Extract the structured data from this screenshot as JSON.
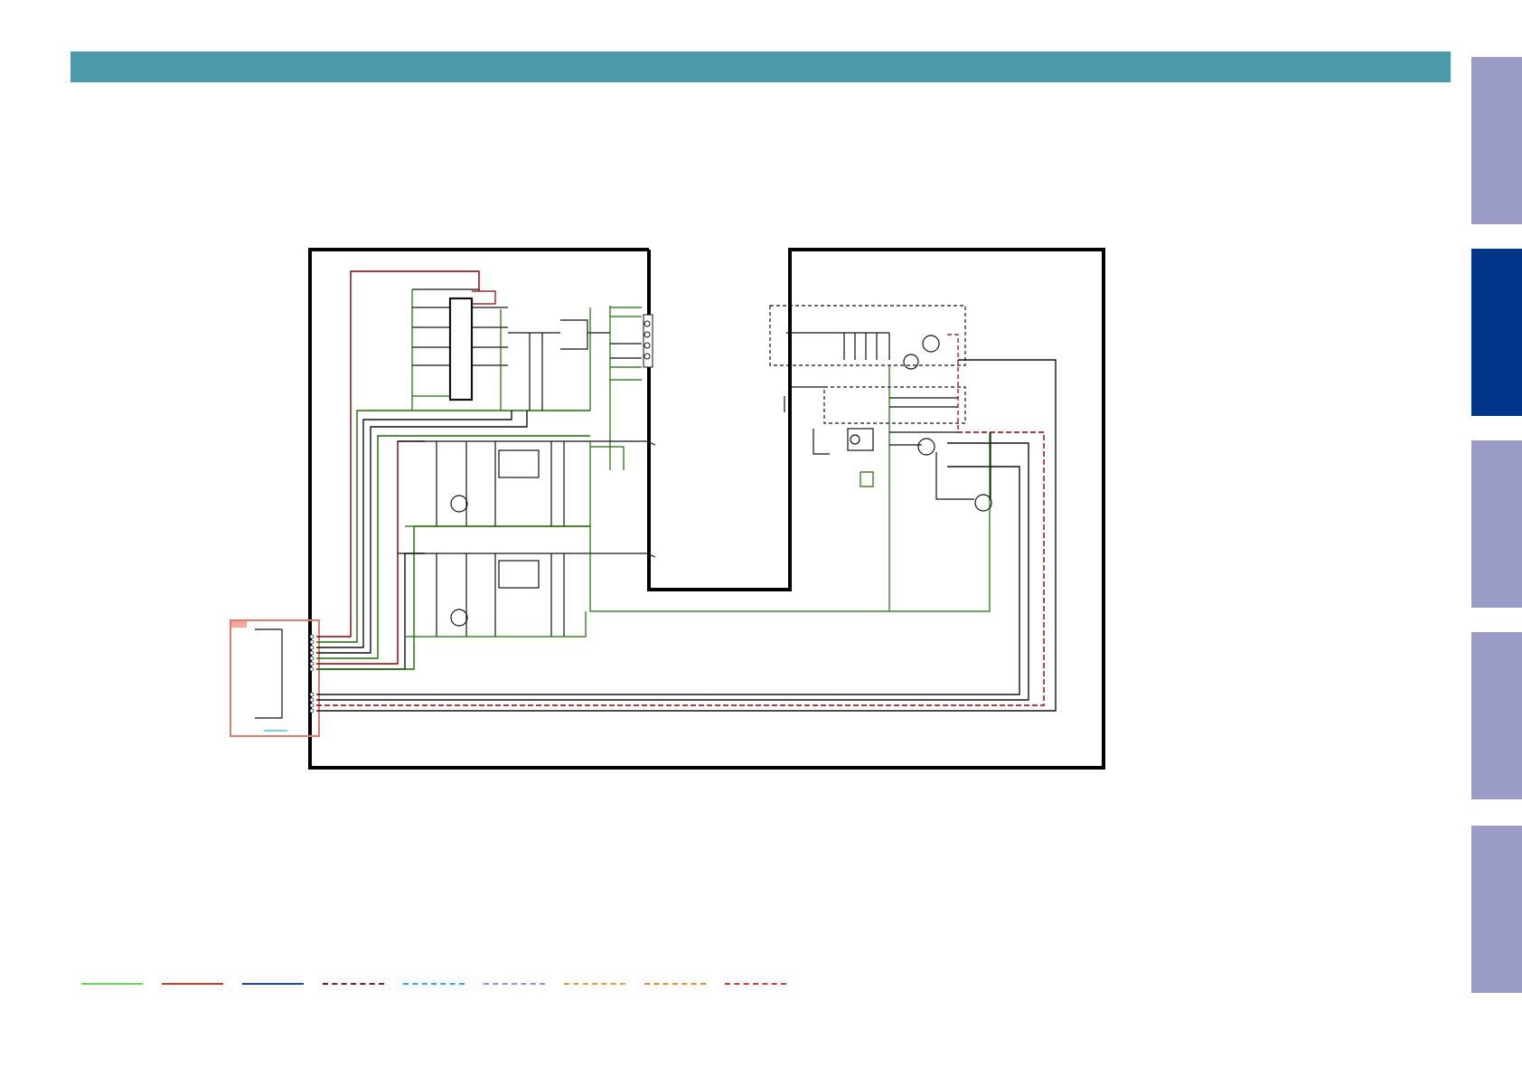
{
  "colors": {
    "header_bar": "#4a9aab",
    "side_tab_inactive": "#9b9bc8",
    "side_tab_active": "#00358a",
    "wire_black": "#111111",
    "wire_green": "#1a6b00",
    "wire_red": "#8b0000",
    "connector_box": "#e07b73",
    "connector_header": "#f2a79a",
    "frame": "#000000"
  },
  "side_tabs": [
    {
      "name": "side-tab-1",
      "active": false
    },
    {
      "name": "side-tab-2",
      "active": true
    },
    {
      "name": "side-tab-3",
      "active": false
    },
    {
      "name": "side-tab-4",
      "active": false
    },
    {
      "name": "side-tab-5",
      "active": false
    }
  ],
  "legend": [
    {
      "color": "#66e04a",
      "style": "solid"
    },
    {
      "color": "#d63b2a",
      "style": "solid"
    },
    {
      "color": "#2244b0",
      "style": "solid"
    },
    {
      "color": "#8b1a1a",
      "style": "dashed"
    },
    {
      "color": "#27b3d3",
      "style": "dashed"
    },
    {
      "color": "#9b8fcf",
      "style": "dashed"
    },
    {
      "color": "#e3a13a",
      "style": "dashed"
    },
    {
      "color": "#f08a30",
      "style": "dashed"
    },
    {
      "color": "#d93a3a",
      "style": "dashed"
    }
  ]
}
